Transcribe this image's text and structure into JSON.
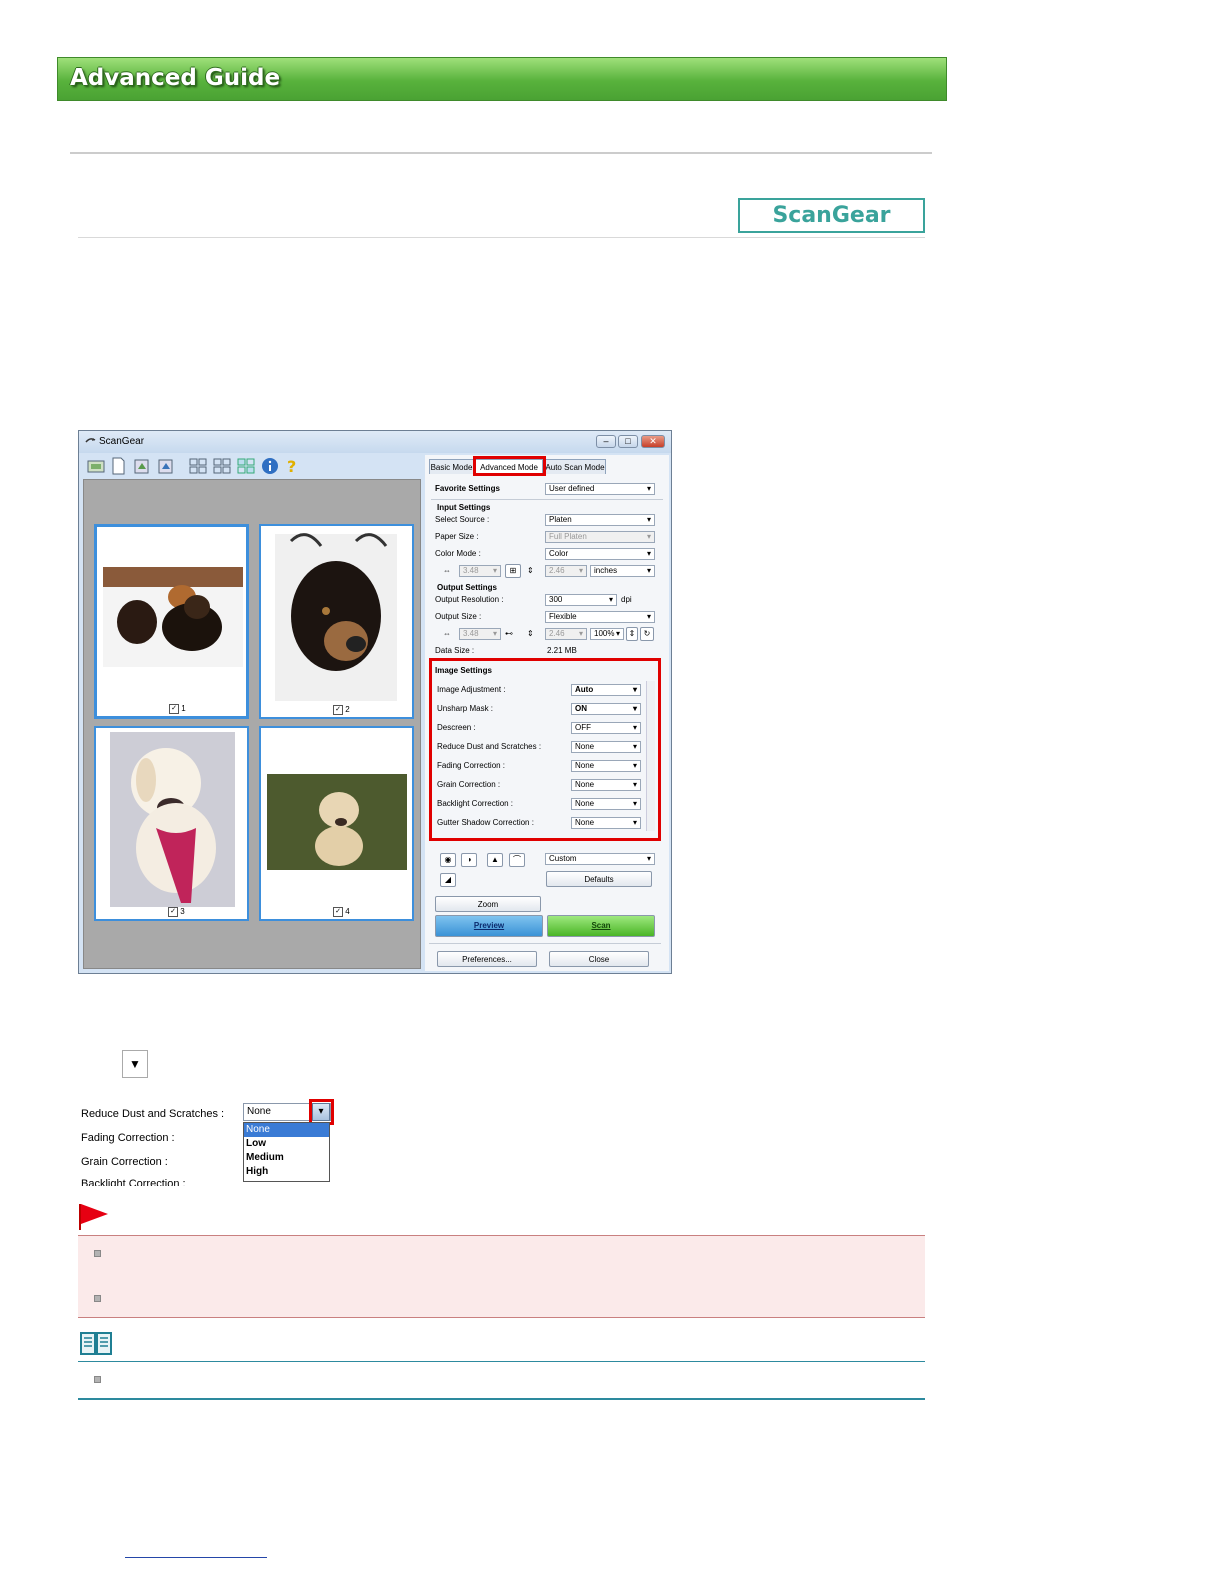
{
  "banner": {
    "title": "Advanced Guide"
  },
  "badge": {
    "label": "ScanGear"
  },
  "window": {
    "title": "ScanGear",
    "tabs": [
      "Basic Mode",
      "Advanced Mode",
      "Auto Scan Mode"
    ],
    "favorite": {
      "label": "Favorite Settings",
      "value": "User defined"
    },
    "input_settings": {
      "heading": "Input Settings",
      "select_source": {
        "label": "Select Source :",
        "value": "Platen"
      },
      "paper_size": {
        "label": "Paper Size :",
        "value": "Full Platen"
      },
      "color_mode": {
        "label": "Color Mode :",
        "value": "Color"
      },
      "width": "3.48",
      "height": "2.46",
      "unit": "inches"
    },
    "output_settings": {
      "heading": "Output Settings",
      "resolution": {
        "label": "Output Resolution :",
        "value": "300",
        "unit": "dpi"
      },
      "size": {
        "label": "Output Size :",
        "value": "Flexible"
      },
      "width": "3.48",
      "height": "2.46",
      "scale": "100%",
      "data_size": {
        "label": "Data Size :",
        "value": "2.21 MB"
      }
    },
    "image_settings": {
      "heading": "Image Settings",
      "rows": [
        {
          "label": "Image Adjustment :",
          "value": "Auto"
        },
        {
          "label": "Unsharp Mask :",
          "value": "ON"
        },
        {
          "label": "Descreen :",
          "value": "OFF"
        },
        {
          "label": "Reduce Dust and Scratches :",
          "value": "None"
        },
        {
          "label": "Fading Correction :",
          "value": "None"
        },
        {
          "label": "Grain Correction :",
          "value": "None"
        },
        {
          "label": "Backlight Correction :",
          "value": "None"
        },
        {
          "label": "Gutter Shadow Correction :",
          "value": "None"
        }
      ]
    },
    "color_adjust": {
      "value": "Custom",
      "defaults": "Defaults"
    },
    "buttons": {
      "zoom": "Zoom",
      "preview": "Preview",
      "scan": "Scan",
      "preferences": "Preferences...",
      "close": "Close"
    },
    "thumbnails": [
      "1",
      "2",
      "3",
      "4"
    ]
  },
  "sample": {
    "labels": [
      "Reduce Dust and Scratches :",
      "Fading Correction :",
      "Grain Correction :",
      "Backlight Correction :"
    ],
    "current": "None",
    "options": [
      "None",
      "Low",
      "Medium",
      "High"
    ]
  },
  "colors": {
    "banner_green": "#58b23c",
    "accent_teal": "#3aa39b",
    "highlight_red": "#e00000",
    "selection_blue": "#3d8fdc"
  }
}
